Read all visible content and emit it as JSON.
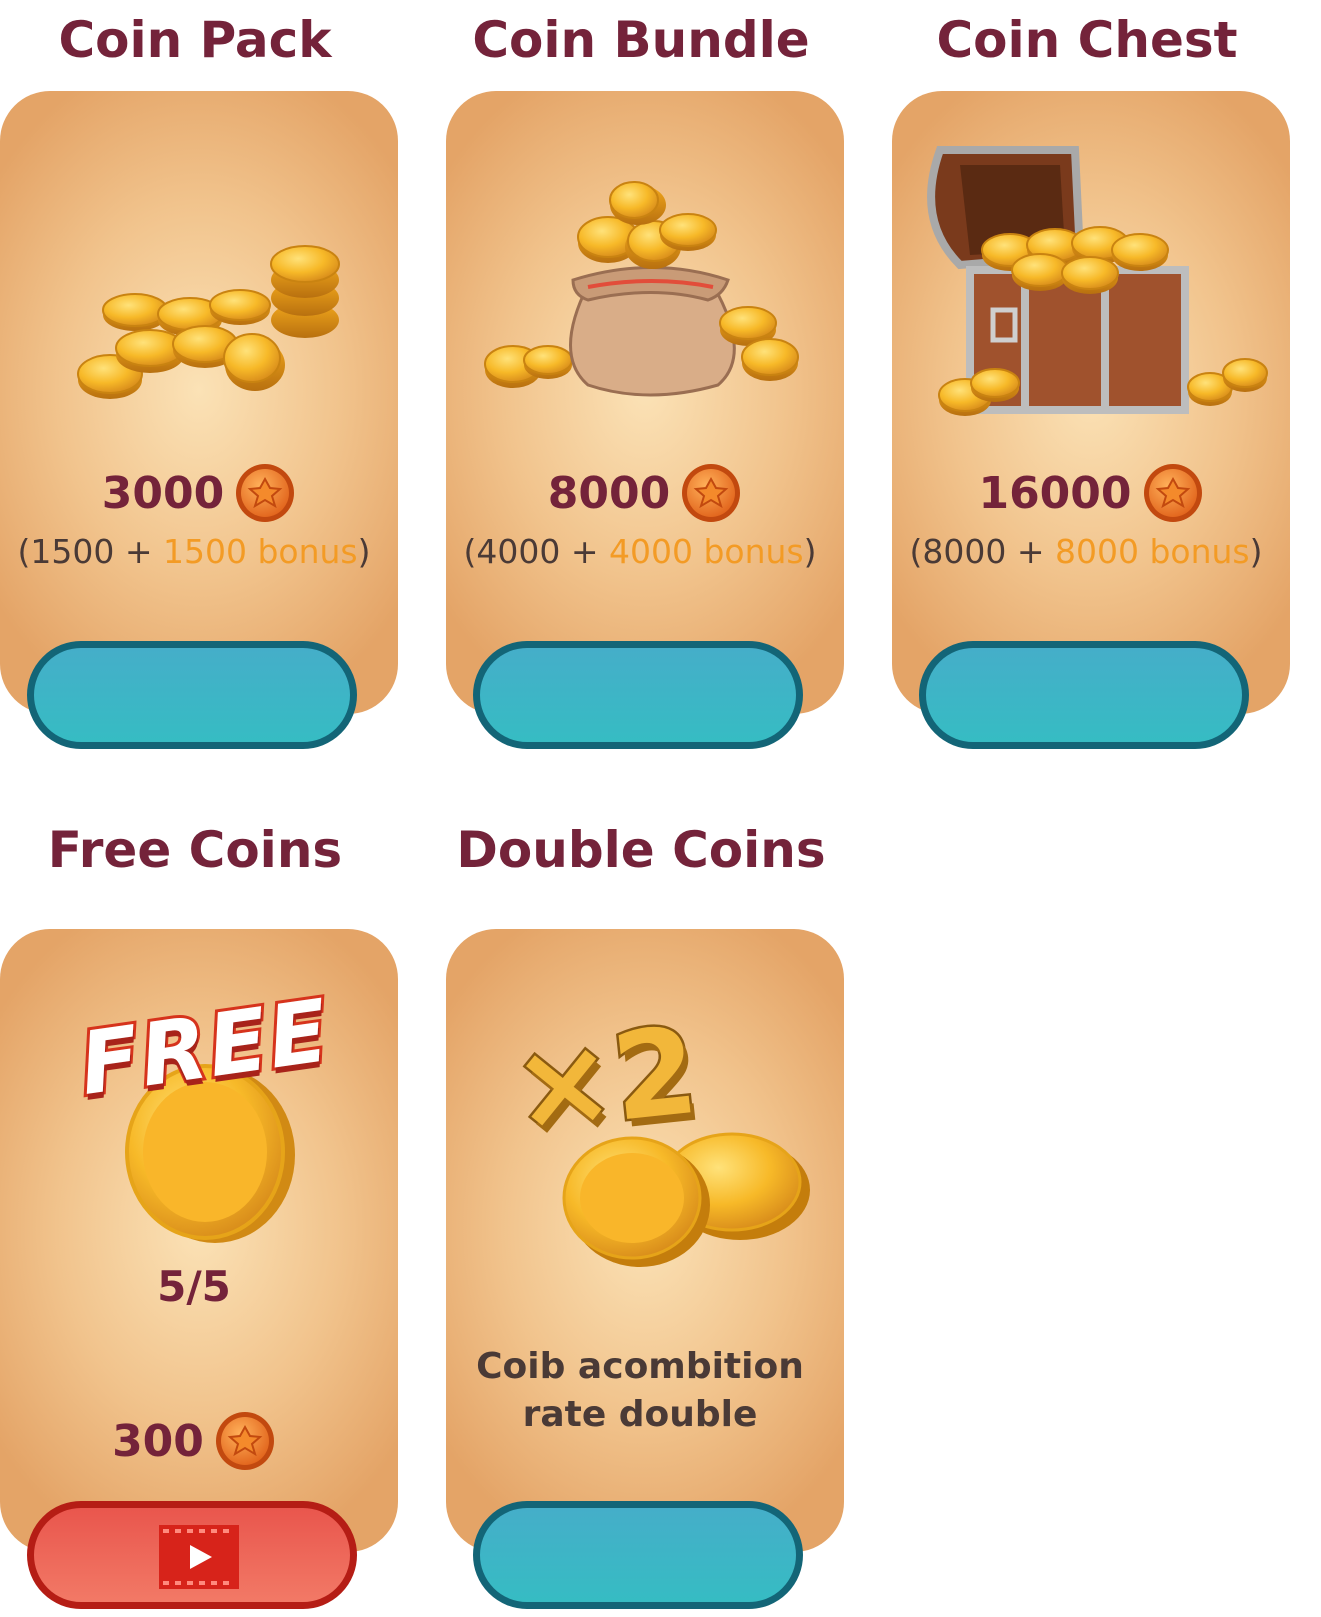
{
  "cards": [
    {
      "title": "Coin Pack",
      "amount": "3000",
      "base": "1500",
      "bonus": "1500 bonus"
    },
    {
      "title": "Coin Bundle",
      "amount": "8000",
      "base": "4000",
      "bonus": "4000 bonus"
    },
    {
      "title": "Coin Chest",
      "amount": "16000",
      "base": "8000",
      "bonus": "8000 bonus"
    }
  ],
  "free": {
    "title": "Free Coins",
    "badge": "FREE",
    "progress": "5/5",
    "reward": "300"
  },
  "double": {
    "title": "Double Coins",
    "badge": "×2",
    "line1": "Coib acombition",
    "line2": "rate double"
  },
  "colors": {
    "title": "#74233a",
    "bonus": "#f39b25",
    "teal_button": "#3ab4c6",
    "red_button": "#ee6658"
  }
}
